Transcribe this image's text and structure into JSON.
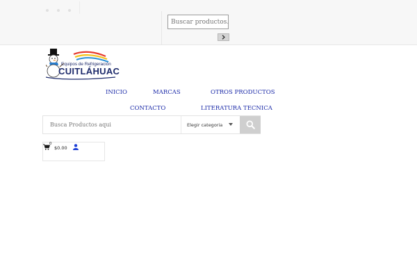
{
  "topbar": {
    "search_placeholder": "Buscar productos..."
  },
  "logo": {
    "line1": "Equipos de Refrigeración",
    "line2": "CUITLÁHUAC"
  },
  "nav": {
    "items": [
      {
        "label": "INICIO"
      },
      {
        "label": "MARCAS"
      },
      {
        "label": "OTROS PRODUCTOS"
      },
      {
        "label": "CONTACTO"
      },
      {
        "label": "LITERATURA TECNICA"
      }
    ]
  },
  "product_search": {
    "placeholder": "Busca Productos aqui",
    "category_selected": "Elegir categoria"
  },
  "cart": {
    "count": "0",
    "total": "$0.00"
  },
  "colors": {
    "nav_link": "#1b2aa8",
    "logo_navy": "#1d2a6b",
    "search_button": "#cfcfcf",
    "user_icon": "#1d3fd6"
  },
  "icons": {
    "search_top": "chevron-right-icon",
    "search_main": "search-icon",
    "cart": "cart-icon",
    "user": "user-icon"
  }
}
